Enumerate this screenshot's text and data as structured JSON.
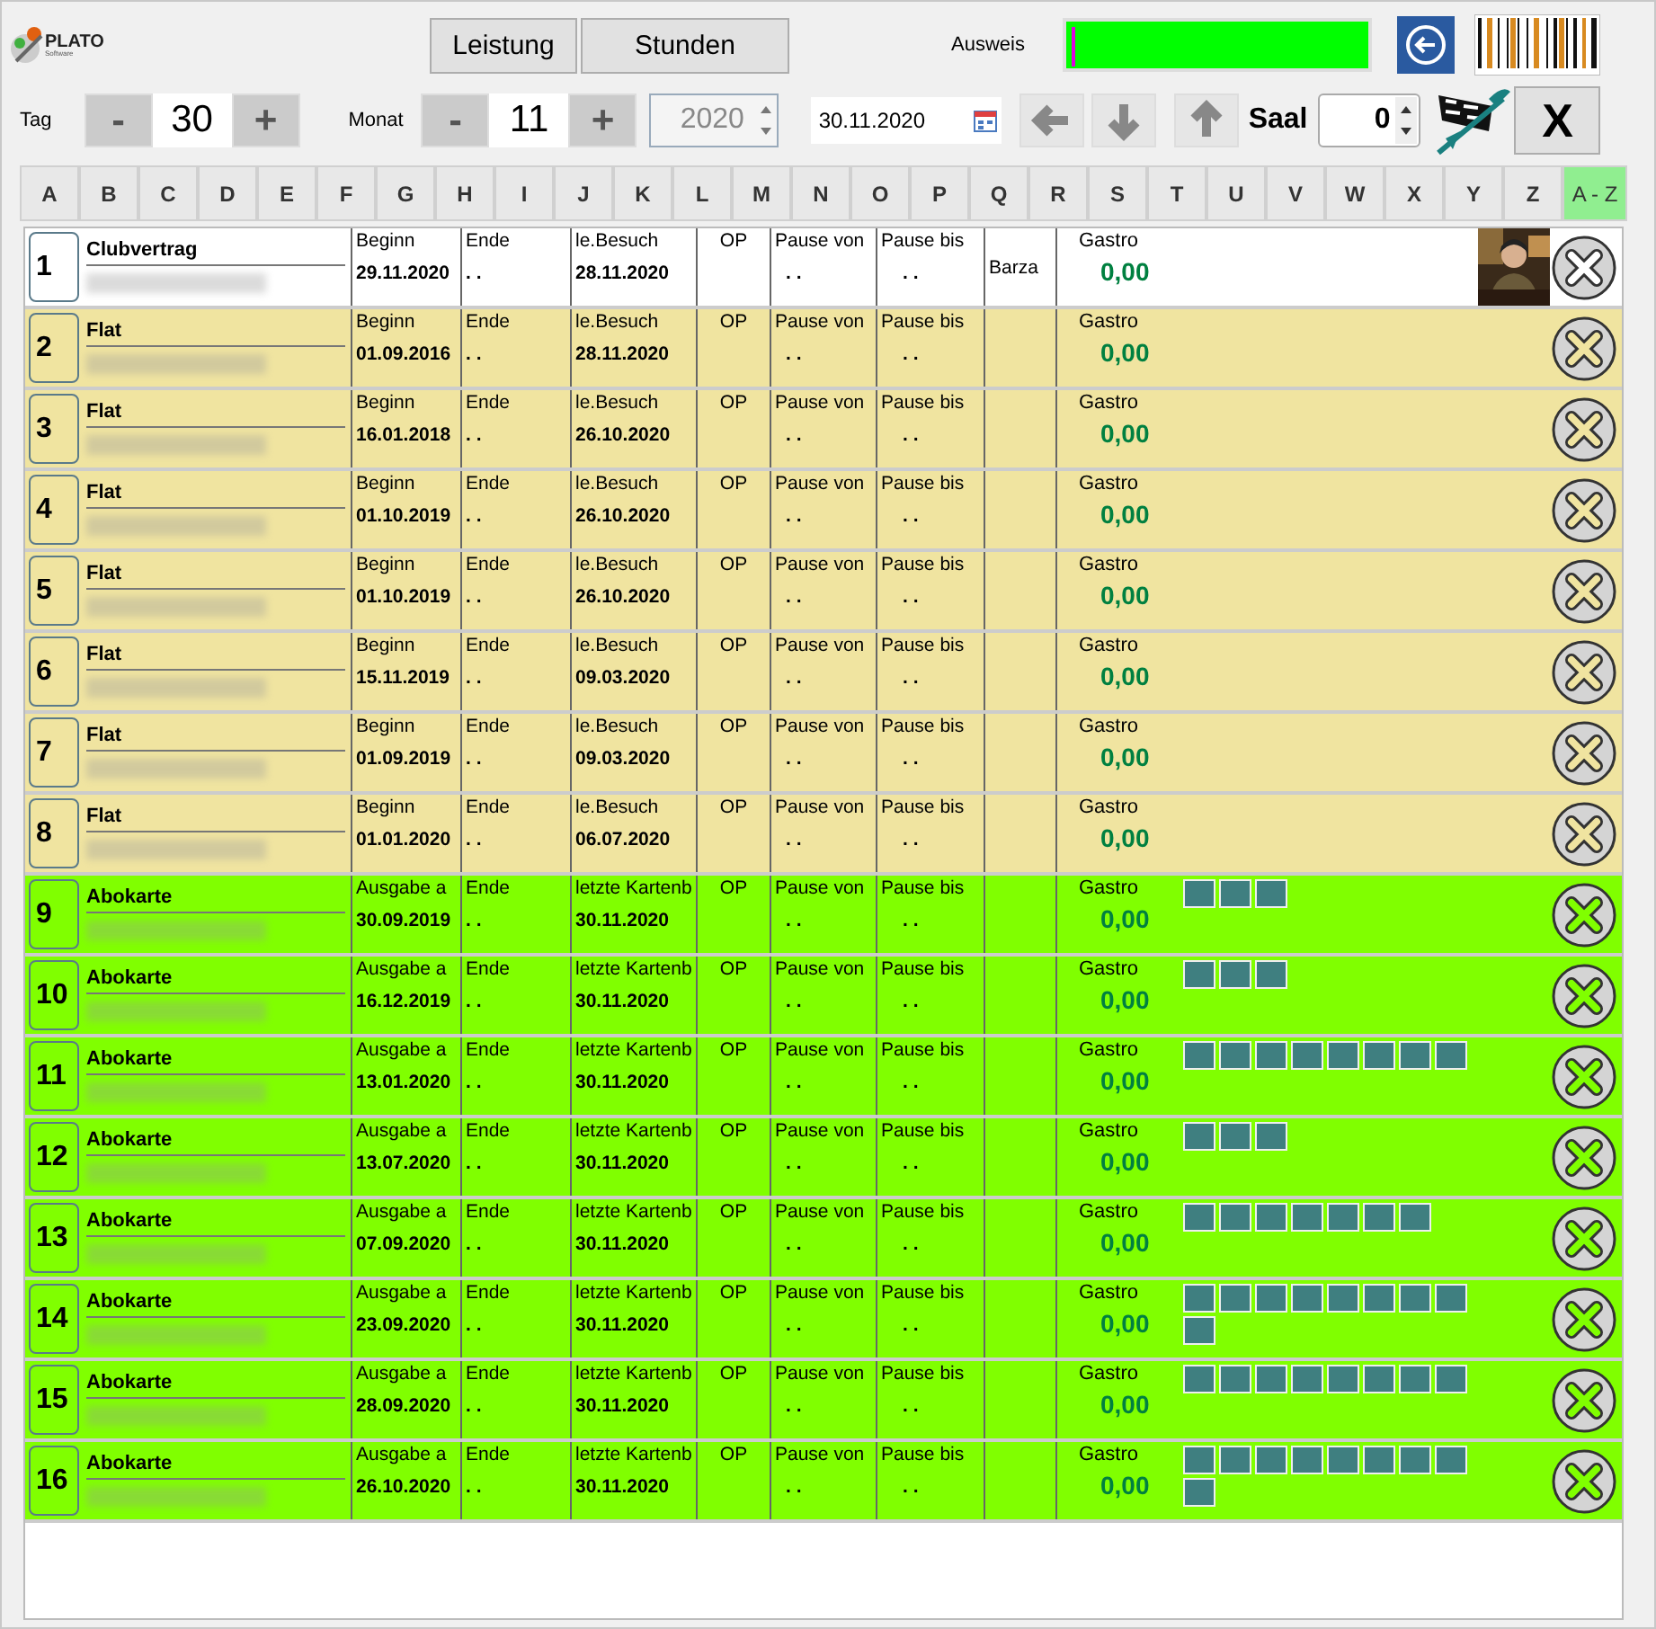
{
  "header": {
    "logo": "PLATO",
    "logo_sub": "Software",
    "buttons": [
      "Leistung",
      "Stunden"
    ],
    "ausweis_label": "Ausweis"
  },
  "controls": {
    "day_label": "Tag",
    "minus": "-",
    "plus": "+",
    "day": "30",
    "month_label": "Monat",
    "month": "11",
    "year": "2020",
    "date": "30.11.2020",
    "saal_label": "Saal",
    "saal": "0",
    "close": "X"
  },
  "letters": [
    {
      "label": "A",
      "selected": false
    },
    {
      "label": "B",
      "selected": false
    },
    {
      "label": "C",
      "selected": false
    },
    {
      "label": "D",
      "selected": false
    },
    {
      "label": "E",
      "selected": false
    },
    {
      "label": "F",
      "selected": false
    },
    {
      "label": "G",
      "selected": false
    },
    {
      "label": "H",
      "selected": false
    },
    {
      "label": "I",
      "selected": false
    },
    {
      "label": "J",
      "selected": false
    },
    {
      "label": "K",
      "selected": false
    },
    {
      "label": "L",
      "selected": false
    },
    {
      "label": "M",
      "selected": false
    },
    {
      "label": "N",
      "selected": false
    },
    {
      "label": "O",
      "selected": false
    },
    {
      "label": "P",
      "selected": false
    },
    {
      "label": "Q",
      "selected": false
    },
    {
      "label": "R",
      "selected": false
    },
    {
      "label": "S",
      "selected": false
    },
    {
      "label": "T",
      "selected": false
    },
    {
      "label": "U",
      "selected": false
    },
    {
      "label": "V",
      "selected": false
    },
    {
      "label": "W",
      "selected": false
    },
    {
      "label": "X",
      "selected": false
    },
    {
      "label": "Y",
      "selected": false
    },
    {
      "label": "Z",
      "selected": false
    },
    {
      "label": "A - Z",
      "selected": true
    }
  ],
  "rows": [
    {
      "number": "1",
      "kind": "clubvertrag",
      "type": "Clubvertrag",
      "start_label": "Beginn",
      "start": "29.11.2020",
      "end_label": "Ende",
      "end": ". .",
      "visit_label": "le.Besuch",
      "visit": "28.11.2020",
      "op": "OP",
      "pause_from_label": "Pause von",
      "pause_from": ". .",
      "pause_to_label": "Pause bis",
      "pause_to": ". .",
      "extra": "Barza",
      "gastro_label": "Gastro",
      "gastro": "0,00",
      "punches": [],
      "photo": true
    },
    {
      "number": "2",
      "kind": "flat",
      "type": "Flat",
      "start_label": "Beginn",
      "start": "01.09.2016",
      "end_label": "Ende",
      "end": ". .",
      "visit_label": "le.Besuch",
      "visit": "28.11.2020",
      "op": "OP",
      "pause_from_label": "Pause von",
      "pause_from": ". .",
      "pause_to_label": "Pause bis",
      "pause_to": ". .",
      "gastro_label": "Gastro",
      "gastro": "0,00",
      "punches": [],
      "photo": false
    },
    {
      "number": "3",
      "kind": "flat",
      "type": "Flat",
      "start_label": "Beginn",
      "start": "16.01.2018",
      "end_label": "Ende",
      "end": ". .",
      "visit_label": "le.Besuch",
      "visit": "26.10.2020",
      "op": "OP",
      "pause_from_label": "Pause von",
      "pause_from": ". .",
      "pause_to_label": "Pause bis",
      "pause_to": ". .",
      "gastro_label": "Gastro",
      "gastro": "0,00",
      "punches": [],
      "photo": false
    },
    {
      "number": "4",
      "kind": "flat",
      "type": "Flat",
      "start_label": "Beginn",
      "start": "01.10.2019",
      "end_label": "Ende",
      "end": ". .",
      "visit_label": "le.Besuch",
      "visit": "26.10.2020",
      "op": "OP",
      "pause_from_label": "Pause von",
      "pause_from": ". .",
      "pause_to_label": "Pause bis",
      "pause_to": ". .",
      "gastro_label": "Gastro",
      "gastro": "0,00",
      "punches": [],
      "photo": false
    },
    {
      "number": "5",
      "kind": "flat",
      "type": "Flat",
      "start_label": "Beginn",
      "start": "01.10.2019",
      "end_label": "Ende",
      "end": ". .",
      "visit_label": "le.Besuch",
      "visit": "26.10.2020",
      "op": "OP",
      "pause_from_label": "Pause von",
      "pause_from": ". .",
      "pause_to_label": "Pause bis",
      "pause_to": ". .",
      "gastro_label": "Gastro",
      "gastro": "0,00",
      "punches": [],
      "photo": false
    },
    {
      "number": "6",
      "kind": "flat",
      "type": "Flat",
      "start_label": "Beginn",
      "start": "15.11.2019",
      "end_label": "Ende",
      "end": ". .",
      "visit_label": "le.Besuch",
      "visit": "09.03.2020",
      "op": "OP",
      "pause_from_label": "Pause von",
      "pause_from": ". .",
      "pause_to_label": "Pause bis",
      "pause_to": ". .",
      "gastro_label": "Gastro",
      "gastro": "0,00",
      "punches": [],
      "photo": false
    },
    {
      "number": "7",
      "kind": "flat",
      "type": "Flat",
      "start_label": "Beginn",
      "start": "01.09.2019",
      "end_label": "Ende",
      "end": ". .",
      "visit_label": "le.Besuch",
      "visit": "09.03.2020",
      "op": "OP",
      "pause_from_label": "Pause von",
      "pause_from": ". .",
      "pause_to_label": "Pause bis",
      "pause_to": ". .",
      "gastro_label": "Gastro",
      "gastro": "0,00",
      "punches": [],
      "photo": false
    },
    {
      "number": "8",
      "kind": "flat",
      "type": "Flat",
      "start_label": "Beginn",
      "start": "01.01.2020",
      "end_label": "Ende",
      "end": ". .",
      "visit_label": "le.Besuch",
      "visit": "06.07.2020",
      "op": "OP",
      "pause_from_label": "Pause von",
      "pause_from": ". .",
      "pause_to_label": "Pause bis",
      "pause_to": ". .",
      "gastro_label": "Gastro",
      "gastro": "0,00",
      "punches": [],
      "photo": false
    },
    {
      "number": "9",
      "kind": "abokarte",
      "type": "Abokarte",
      "start_label": "Ausgabe a",
      "start": "30.09.2019",
      "end_label": "Ende",
      "end": ". .",
      "visit_label": "letzte Kartenb",
      "visit": "30.11.2020",
      "op": "OP",
      "pause_from_label": "Pause von",
      "pause_from": ". .",
      "pause_to_label": "Pause bis",
      "pause_to": ". .",
      "gastro_label": "Gastro",
      "gastro": "0,00",
      "punches": [
        {
          "kind": "punch"
        },
        {
          "kind": "punch"
        },
        {
          "kind": "punch"
        }
      ],
      "photo": false
    },
    {
      "number": "10",
      "kind": "abokarte",
      "type": "Abokarte",
      "start_label": "Ausgabe a",
      "start": "16.12.2019",
      "end_label": "Ende",
      "end": ". .",
      "visit_label": "letzte Kartenb",
      "visit": "30.11.2020",
      "op": "OP",
      "pause_from_label": "Pause von",
      "pause_from": ". .",
      "pause_to_label": "Pause bis",
      "pause_to": ". .",
      "gastro_label": "Gastro",
      "gastro": "0,00",
      "punches": [
        {
          "kind": "punch"
        },
        {
          "kind": "punch"
        },
        {
          "kind": "punch"
        }
      ],
      "photo": false
    },
    {
      "number": "11",
      "kind": "abokarte",
      "type": "Abokarte",
      "start_label": "Ausgabe a",
      "start": "13.01.2020",
      "end_label": "Ende",
      "end": ". .",
      "visit_label": "letzte Kartenb",
      "visit": "30.11.2020",
      "op": "OP",
      "pause_from_label": "Pause von",
      "pause_from": ". .",
      "pause_to_label": "Pause bis",
      "pause_to": ". .",
      "gastro_label": "Gastro",
      "gastro": "0,00",
      "punches": [
        {
          "kind": "punch"
        },
        {
          "kind": "punch"
        },
        {
          "kind": "punch"
        },
        {
          "kind": "punch"
        },
        {
          "kind": "punch"
        },
        {
          "kind": "punch"
        },
        {
          "kind": "punch"
        },
        {
          "kind": "punch"
        }
      ],
      "photo": false
    },
    {
      "number": "12",
      "kind": "abokarte",
      "type": "Abokarte",
      "start_label": "Ausgabe a",
      "start": "13.07.2020",
      "end_label": "Ende",
      "end": ". .",
      "visit_label": "letzte Kartenb",
      "visit": "30.11.2020",
      "op": "OP",
      "pause_from_label": "Pause von",
      "pause_from": ". .",
      "pause_to_label": "Pause bis",
      "pause_to": ". .",
      "gastro_label": "Gastro",
      "gastro": "0,00",
      "punches": [
        {
          "kind": "punch"
        },
        {
          "kind": "punch"
        },
        {
          "kind": "punch"
        }
      ],
      "photo": false
    },
    {
      "number": "13",
      "kind": "abokarte",
      "type": "Abokarte",
      "start_label": "Ausgabe a",
      "start": "07.09.2020",
      "end_label": "Ende",
      "end": ". .",
      "visit_label": "letzte Kartenb",
      "visit": "30.11.2020",
      "op": "OP",
      "pause_from_label": "Pause von",
      "pause_from": ". .",
      "pause_to_label": "Pause bis",
      "pause_to": ". .",
      "gastro_label": "Gastro",
      "gastro": "0,00",
      "punches": [
        {
          "kind": "punch"
        },
        {
          "kind": "punch"
        },
        {
          "kind": "punch"
        },
        {
          "kind": "punch"
        },
        {
          "kind": "punch"
        },
        {
          "kind": "punch"
        },
        {
          "kind": "punch"
        }
      ],
      "photo": false
    },
    {
      "number": "14",
      "kind": "abokarte",
      "type": "Abokarte",
      "start_label": "Ausgabe a",
      "start": "23.09.2020",
      "end_label": "Ende",
      "end": ". .",
      "visit_label": "letzte Kartenb",
      "visit": "30.11.2020",
      "op": "OP",
      "pause_from_label": "Pause von",
      "pause_from": ". .",
      "pause_to_label": "Pause bis",
      "pause_to": ". .",
      "gastro_label": "Gastro",
      "gastro": "0,00",
      "punches": [
        {
          "kind": "punch"
        },
        {
          "kind": "punch"
        },
        {
          "kind": "punch"
        },
        {
          "kind": "punch"
        },
        {
          "kind": "punch"
        },
        {
          "kind": "punch"
        },
        {
          "kind": "punch"
        },
        {
          "kind": "punch"
        },
        {
          "kind": "punch"
        }
      ],
      "photo": false
    },
    {
      "number": "15",
      "kind": "abokarte",
      "type": "Abokarte",
      "start_label": "Ausgabe a",
      "start": "28.09.2020",
      "end_label": "Ende",
      "end": ". .",
      "visit_label": "letzte Kartenb",
      "visit": "30.11.2020",
      "op": "OP",
      "pause_from_label": "Pause von",
      "pause_from": ". .",
      "pause_to_label": "Pause bis",
      "pause_to": ". .",
      "gastro_label": "Gastro",
      "gastro": "0,00",
      "punches": [
        {
          "kind": "punch"
        },
        {
          "kind": "punch"
        },
        {
          "kind": "punch"
        },
        {
          "kind": "punch"
        },
        {
          "kind": "punch"
        },
        {
          "kind": "punch"
        },
        {
          "kind": "punch"
        },
        {
          "kind": "punch"
        }
      ],
      "photo": false
    },
    {
      "number": "16",
      "kind": "abokarte",
      "type": "Abokarte",
      "start_label": "Ausgabe a",
      "start": "26.10.2020",
      "end_label": "Ende",
      "end": ". .",
      "visit_label": "letzte Kartenb",
      "visit": "30.11.2020",
      "op": "OP",
      "pause_from_label": "Pause von",
      "pause_from": ". .",
      "pause_to_label": "Pause bis",
      "pause_to": ". .",
      "gastro_label": "Gastro",
      "gastro": "0,00",
      "punches": [
        {
          "kind": "punch"
        },
        {
          "kind": "punch"
        },
        {
          "kind": "punch"
        },
        {
          "kind": "punch"
        },
        {
          "kind": "punch"
        },
        {
          "kind": "punch"
        },
        {
          "kind": "punch"
        },
        {
          "kind": "punch"
        },
        {
          "kind": "punch"
        }
      ],
      "photo": false
    }
  ]
}
